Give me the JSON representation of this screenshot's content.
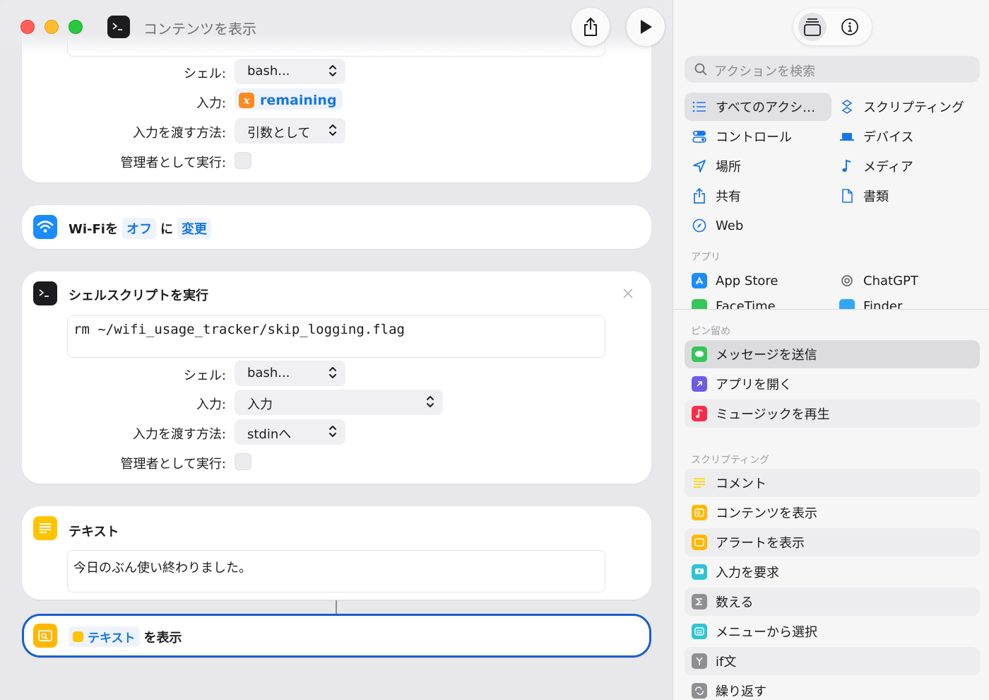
{
  "window": {
    "title": "コンテンツを表示"
  },
  "top_shell_block": {
    "shell_label": "シェル:",
    "shell_value": "bash...",
    "input_label": "入力:",
    "input_variable": "remaining",
    "pass_label": "入力を渡す方法:",
    "pass_value": "引数として",
    "admin_label": "管理者として実行:"
  },
  "wifi_block": {
    "prefix": "Wi-Fiを",
    "state": "オフ",
    "mid": "に",
    "action": "変更"
  },
  "shell_block": {
    "title": "シェルスクリプトを実行",
    "script": "rm ~/wifi_usage_tracker/skip_logging.flag",
    "shell_label": "シェル:",
    "shell_value": "bash...",
    "input_label": "入力:",
    "input_value": "入力",
    "pass_label": "入力を渡す方法:",
    "pass_value": "stdinへ",
    "admin_label": "管理者として実行:"
  },
  "text_block": {
    "title": "テキスト",
    "content": "今日のぶん使い終わりました。"
  },
  "show_block": {
    "token": "テキスト",
    "suffix": "を表示"
  },
  "sidebar": {
    "search_placeholder": "アクションを検索",
    "categories": [
      {
        "label": "すべてのアクシ…",
        "icon": "list-icon"
      },
      {
        "label": "スクリプティング",
        "icon": "scripting-icon"
      },
      {
        "label": "コントロール",
        "icon": "toggle-icon"
      },
      {
        "label": "デバイス",
        "icon": "laptop-icon"
      },
      {
        "label": "場所",
        "icon": "location-icon"
      },
      {
        "label": "メディア",
        "icon": "music-note-icon"
      },
      {
        "label": "共有",
        "icon": "share-icon"
      },
      {
        "label": "書類",
        "icon": "document-icon"
      },
      {
        "label": "Web",
        "icon": "compass-icon"
      }
    ],
    "apps_header": "アプリ",
    "apps": [
      {
        "label": "App Store"
      },
      {
        "label": "ChatGPT"
      },
      {
        "label": "FaceTime"
      },
      {
        "label": "Finder"
      }
    ],
    "pinned_header": "ピン留め",
    "pinned": [
      {
        "label": "メッセージを送信",
        "color": "#34c759"
      },
      {
        "label": "アプリを開く",
        "color": "#6e5ce6"
      },
      {
        "label": "ミュージックを再生",
        "color": "#fa2d48"
      }
    ],
    "scripting_header": "スクリプティング",
    "scripting": [
      {
        "label": "コメント",
        "color": "#ffd60a"
      },
      {
        "label": "コンテンツを表示",
        "color": "#ffb700"
      },
      {
        "label": "アラートを表示",
        "color": "#ffb700"
      },
      {
        "label": "入力を要求",
        "color": "#2ec4d6"
      },
      {
        "label": "数える",
        "color": "#8e8e93"
      },
      {
        "label": "メニューから選択",
        "color": "#2ec4d6"
      },
      {
        "label": "if文",
        "color": "#8e8e93"
      },
      {
        "label": "繰り返す",
        "color": "#8e8e93"
      }
    ]
  },
  "colors": {
    "accent": "#1776e8",
    "selected_outline": "#1a5fc9"
  }
}
